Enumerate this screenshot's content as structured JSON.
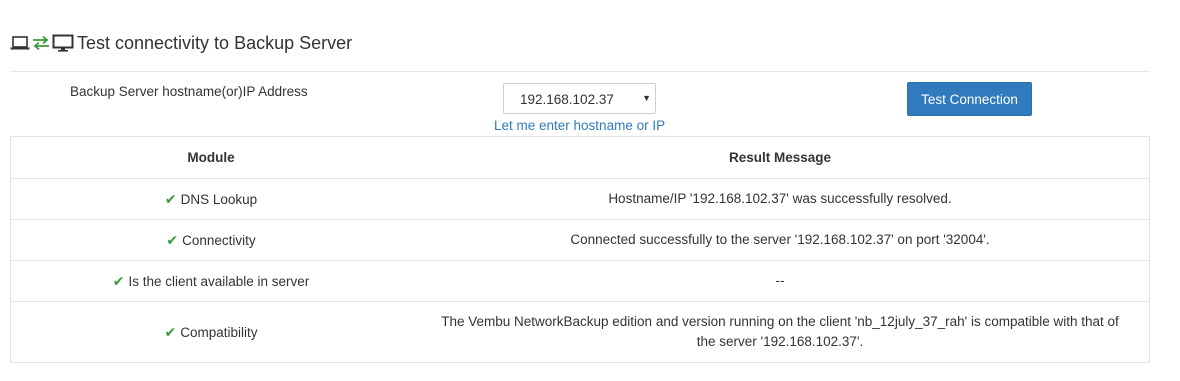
{
  "header": {
    "title": "Test connectivity to Backup Server",
    "icons": [
      "laptop-icon",
      "transfer-arrows-icon",
      "desktop-monitor-icon"
    ],
    "icon_accent": "#3a9a3a"
  },
  "form": {
    "server_label": "Backup Server hostname(or)IP Address",
    "selected_server": "192.168.102.37",
    "caret": "▼",
    "manual_link": "Let me enter hostname or IP",
    "test_button": "Test Connection"
  },
  "table": {
    "headers": {
      "module": "Module",
      "result": "Result Message"
    },
    "check_glyph": "✔",
    "rows": [
      {
        "module": "DNS Lookup",
        "status": "success",
        "message": "Hostname/IP '192.168.102.37' was successfully resolved."
      },
      {
        "module": "Connectivity",
        "status": "success",
        "message": "Connected successfully to the server '192.168.102.37' on port '32004'."
      },
      {
        "module": "Is the client available in server",
        "status": "success",
        "message": "--"
      },
      {
        "module": "Compatibility",
        "status": "success",
        "message": "The Vembu NetworkBackup edition and version running on the client 'nb_12july_37_rah' is compatible with that of the server '192.168.102.37'."
      }
    ]
  },
  "colors": {
    "primary": "#2f7bbd",
    "success": "#3a9a3a",
    "border": "#e3e3e3"
  }
}
